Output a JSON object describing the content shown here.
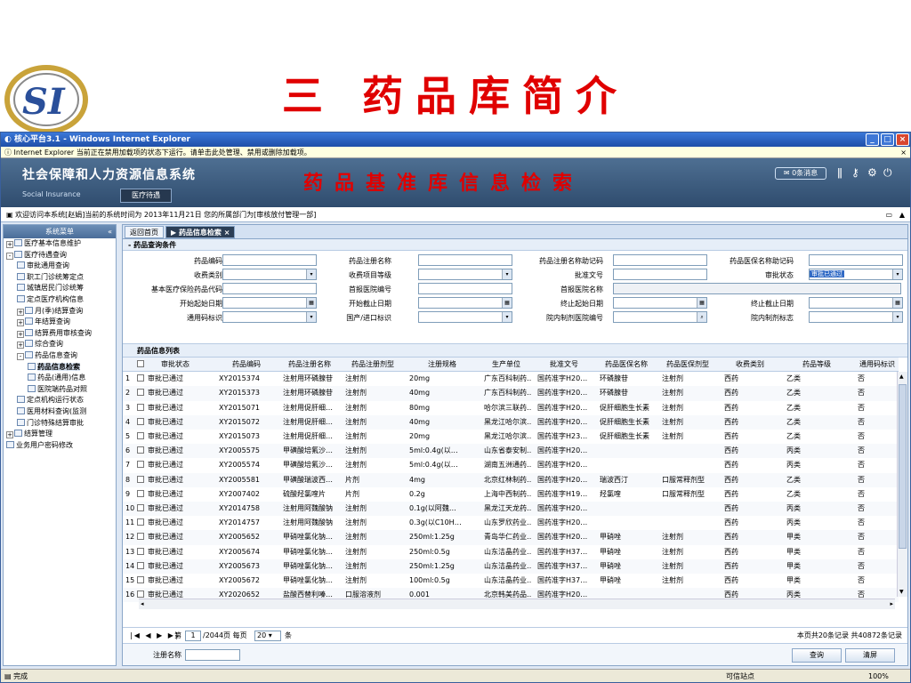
{
  "slide": {
    "title": "三 药品库简介",
    "logo_text": "SI"
  },
  "window": {
    "title": "核心平台3.1 - Windows Internet Explorer",
    "infobar": "Internet Explorer 当前正在禁用加载项的状态下运行。请单击此处管理、禁用或删除加载项。",
    "close_info": "×",
    "system_title": "社会保障和人力资源信息系统",
    "system_subtitle": "Social Insurance",
    "module_tab": "医疗待遇",
    "db_title": "药品基准库信息检索",
    "messages": "0条消息",
    "welcome": "欢迎访问本系统[赵娟]当前的系统时间为 2013年11月21日 您的所属部门为[审核放付管理一部]",
    "status": "完成",
    "status_right": "可信站点",
    "zoom": "100%"
  },
  "sidebar": {
    "header": "系统菜单",
    "items": [
      {
        "label": "医疗基本信息维护",
        "level": 0,
        "toggle": "+"
      },
      {
        "label": "医疗待遇查询",
        "level": 0,
        "toggle": "-"
      },
      {
        "label": "审批通用查询",
        "level": 1
      },
      {
        "label": "职工门诊统筹定点",
        "level": 1
      },
      {
        "label": "城镇居民门诊统筹",
        "level": 1
      },
      {
        "label": "定点医疗机构信息",
        "level": 1
      },
      {
        "label": "月(季)结算查询",
        "level": 1,
        "toggle": "+"
      },
      {
        "label": "年结算查询",
        "level": 1,
        "toggle": "+"
      },
      {
        "label": "结算费用审核查询",
        "level": 1,
        "toggle": "+"
      },
      {
        "label": "综合查询",
        "level": 1,
        "toggle": "+"
      },
      {
        "label": "药品信息查询",
        "level": 1,
        "toggle": "-"
      },
      {
        "label": "药品信息检索",
        "level": 2,
        "selected": true
      },
      {
        "label": "药品(通用)信息",
        "level": 2
      },
      {
        "label": "医院端药品对照",
        "level": 2
      },
      {
        "label": "定点机构运行状态",
        "level": 1
      },
      {
        "label": "医用材料查询(监测",
        "level": 1
      },
      {
        "label": "门诊特殊结算审批",
        "level": 1
      },
      {
        "label": "结算管理",
        "level": 0,
        "toggle": "+"
      },
      {
        "label": "业务用户密码修改",
        "level": 0
      }
    ]
  },
  "tabs": {
    "home": "返回首页",
    "active": "药品信息检索"
  },
  "query": {
    "section_title": "药品查询条件",
    "fields": {
      "drug_code": "药品编码",
      "reg_name": "药品注册名称",
      "reg_name_code": "药品注册名称助记码",
      "insurance_name_code": "药品医保名称助记码",
      "fee_type": "收费类别",
      "fee_level": "收费项目等级",
      "approval_no": "批准文号",
      "approval_status": "审批状态",
      "approval_status_value": "审批已通过",
      "basic_code": "基本医疗保险药品代码",
      "first_hospital_no": "首报医院编号",
      "first_hospital_name": "首报医院名称",
      "start_date": "开始起始日期",
      "start_end_date": "开始截止日期",
      "end_start_date": "终止起始日期",
      "end_end_date": "终止截止日期",
      "generic_flag": "通用码标识",
      "import_flag": "国产/进口标识",
      "hospital_prep_no": "院内制剂医院编号",
      "hospital_prep_flag": "院内制剂标志"
    }
  },
  "list": {
    "title": "药品信息列表",
    "columns": [
      "审批状态",
      "药品编码",
      "药品注册名称",
      "药品注册剂型",
      "注册规格",
      "生产单位",
      "批准文号",
      "药品医保名称",
      "药品医保剂型",
      "收费类别",
      "药品等级",
      "通用码标识"
    ],
    "rows": [
      {
        "n": "1",
        "status": "审批已通过",
        "code": "XY2015374",
        "name": "注射用环磷腺苷",
        "form": "注射剂",
        "spec": "20mg",
        "maker": "广东百科制药…",
        "approval": "国药准字H20…",
        "ins_name": "环磷腺苷",
        "ins_form": "注射剂",
        "fee": "西药",
        "level": "乙类",
        "generic": "否"
      },
      {
        "n": "2",
        "status": "审批已通过",
        "code": "XY2015373",
        "name": "注射用环磷腺苷",
        "form": "注射剂",
        "spec": "40mg",
        "maker": "广东百科制药…",
        "approval": "国药准字H20…",
        "ins_name": "环磷腺苷",
        "ins_form": "注射剂",
        "fee": "西药",
        "level": "乙类",
        "generic": "否"
      },
      {
        "n": "3",
        "status": "审批已通过",
        "code": "XY2015071",
        "name": "注射用促肝细…",
        "form": "注射剂",
        "spec": "80mg",
        "maker": "哈尔滨三联药…",
        "approval": "国药准字H20…",
        "ins_name": "促肝细胞生长素",
        "ins_form": "注射剂",
        "fee": "西药",
        "level": "乙类",
        "generic": "否"
      },
      {
        "n": "4",
        "status": "审批已通过",
        "code": "XY2015072",
        "name": "注射用促肝细…",
        "form": "注射剂",
        "spec": "40mg",
        "maker": "黑龙江哈尔滨…",
        "approval": "国药准字H20…",
        "ins_name": "促肝细胞生长素",
        "ins_form": "注射剂",
        "fee": "西药",
        "level": "乙类",
        "generic": "否"
      },
      {
        "n": "5",
        "status": "审批已通过",
        "code": "XY2015073",
        "name": "注射用促肝细…",
        "form": "注射剂",
        "spec": "20mg",
        "maker": "黑龙江哈尔滨…",
        "approval": "国药准字H23…",
        "ins_name": "促肝细胞生长素",
        "ins_form": "注射剂",
        "fee": "西药",
        "level": "乙类",
        "generic": "否"
      },
      {
        "n": "6",
        "status": "审批已通过",
        "code": "XY2005575",
        "name": "甲磺酸培氟沙…",
        "form": "注射剂",
        "spec": "5ml:0.4g(以…",
        "maker": "山东省泰安制…",
        "approval": "国药准字H20…",
        "ins_name": "",
        "ins_form": "",
        "fee": "西药",
        "level": "丙类",
        "generic": "否"
      },
      {
        "n": "7",
        "status": "审批已通过",
        "code": "XY2005574",
        "name": "甲磺酸培氟沙…",
        "form": "注射剂",
        "spec": "5ml:0.4g(以…",
        "maker": "湖南五洲通药…",
        "approval": "国药准字H20…",
        "ins_name": "",
        "ins_form": "",
        "fee": "西药",
        "level": "丙类",
        "generic": "否"
      },
      {
        "n": "8",
        "status": "审批已通过",
        "code": "XY2005581",
        "name": "甲磺酸瑞波西…",
        "form": "片剂",
        "spec": "4mg",
        "maker": "北京红林制药…",
        "approval": "国药准字H20…",
        "ins_name": "瑞波西汀",
        "ins_form": "口服常释剂型",
        "fee": "西药",
        "level": "乙类",
        "generic": "否"
      },
      {
        "n": "9",
        "status": "审批已通过",
        "code": "XY2007402",
        "name": "硫酸羟氯喹片",
        "form": "片剂",
        "spec": "0.2g",
        "maker": "上海中西制药…",
        "approval": "国药准字H19…",
        "ins_name": "羟氯喹",
        "ins_form": "口服常释剂型",
        "fee": "西药",
        "level": "乙类",
        "generic": "否"
      },
      {
        "n": "10",
        "status": "审批已通过",
        "code": "XY2014758",
        "name": "注射用阿魏酸钠",
        "form": "注射剂",
        "spec": "0.1g(以阿魏…",
        "maker": "黑龙江天龙药…",
        "approval": "国药准字H20…",
        "ins_name": "",
        "ins_form": "",
        "fee": "西药",
        "level": "丙类",
        "generic": "否"
      },
      {
        "n": "11",
        "status": "审批已通过",
        "code": "XY2014757",
        "name": "注射用阿魏酸钠",
        "form": "注射剂",
        "spec": "0.3g(以C10H…",
        "maker": "山东罗欣药业…",
        "approval": "国药准字H20…",
        "ins_name": "",
        "ins_form": "",
        "fee": "西药",
        "level": "丙类",
        "generic": "否"
      },
      {
        "n": "12",
        "status": "审批已通过",
        "code": "XY2005652",
        "name": "甲硝唑氯化钠…",
        "form": "注射剂",
        "spec": "250ml:1.25g",
        "maker": "青岛华仁药业…",
        "approval": "国药准字H20…",
        "ins_name": "甲硝唑",
        "ins_form": "注射剂",
        "fee": "西药",
        "level": "甲类",
        "generic": "否"
      },
      {
        "n": "13",
        "status": "审批已通过",
        "code": "XY2005674",
        "name": "甲硝唑氯化钠…",
        "form": "注射剂",
        "spec": "250ml:0.5g",
        "maker": "山东洁晶药业…",
        "approval": "国药准字H37…",
        "ins_name": "甲硝唑",
        "ins_form": "注射剂",
        "fee": "西药",
        "level": "甲类",
        "generic": "否"
      },
      {
        "n": "14",
        "status": "审批已通过",
        "code": "XY2005673",
        "name": "甲硝唑氯化钠…",
        "form": "注射剂",
        "spec": "250ml:1.25g",
        "maker": "山东洁晶药业…",
        "approval": "国药准字H37…",
        "ins_name": "甲硝唑",
        "ins_form": "注射剂",
        "fee": "西药",
        "level": "甲类",
        "generic": "否"
      },
      {
        "n": "15",
        "status": "审批已通过",
        "code": "XY2005672",
        "name": "甲硝唑氯化钠…",
        "form": "注射剂",
        "spec": "100ml:0.5g",
        "maker": "山东洁晶药业…",
        "approval": "国药准字H37…",
        "ins_name": "甲硝唑",
        "ins_form": "注射剂",
        "fee": "西药",
        "level": "甲类",
        "generic": "否"
      },
      {
        "n": "16",
        "status": "审批已通过",
        "code": "XY2020652",
        "name": "盐酸西替利嗪…",
        "form": "口服溶液剂",
        "spec": "0.001",
        "maker": "北京韩美药品…",
        "approval": "国药准字H20…",
        "ins_name": "",
        "ins_form": "",
        "fee": "西药",
        "level": "丙类",
        "generic": "否"
      }
    ]
  },
  "pager": {
    "prefix": "第",
    "page": "1",
    "of": "/2044页 每页",
    "per_page": "20",
    "suffix": "条",
    "summary": "本页共20条记录 共40872条记录"
  },
  "bottom": {
    "search_label": "注册名称",
    "query_button": "查询",
    "clear_button": "清屏"
  }
}
